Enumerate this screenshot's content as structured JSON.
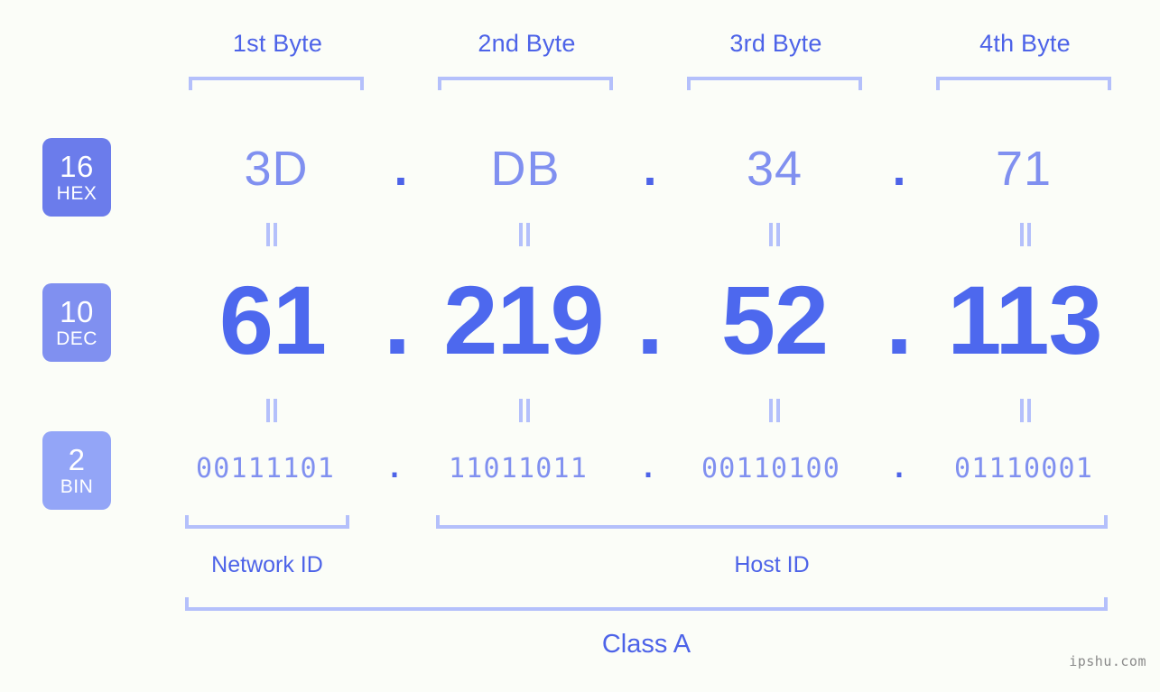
{
  "meta": {
    "background_color": "#fbfdf8",
    "accent_dark": "#4d63e8",
    "accent_mid": "#8090f0",
    "accent_light": "#b4c0fb",
    "decimal_color": "#4d68ee"
  },
  "byte_headers": [
    {
      "label": "1st Byte"
    },
    {
      "label": "2nd Byte"
    },
    {
      "label": "3rd Byte"
    },
    {
      "label": "4th Byte"
    }
  ],
  "badges": [
    {
      "base": "16",
      "name": "HEX",
      "color": "#6b7ceb"
    },
    {
      "base": "10",
      "name": "DEC",
      "color": "#8090f0"
    },
    {
      "base": "2",
      "name": "BIN",
      "color": "#93a5f7"
    }
  ],
  "separator": ".",
  "rows": {
    "hex": {
      "values": [
        "3D",
        "DB",
        "34",
        "71"
      ]
    },
    "dec": {
      "values": [
        "61",
        "219",
        "52",
        "113"
      ]
    },
    "bin": {
      "values": [
        "00111101",
        "11011011",
        "00110100",
        "01110001"
      ]
    }
  },
  "sections": [
    {
      "label": "Network ID"
    },
    {
      "label": "Host ID"
    }
  ],
  "class": {
    "label": "Class A"
  },
  "watermark": {
    "text": "ipshu.com"
  }
}
